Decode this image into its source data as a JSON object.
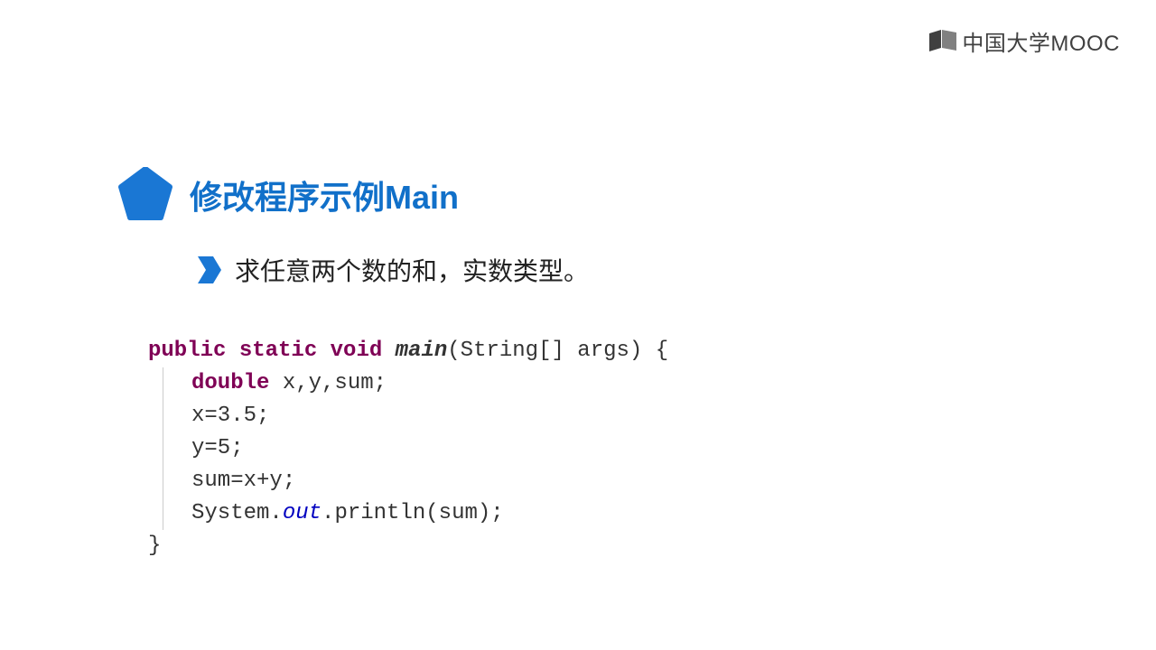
{
  "logo": {
    "text": "中国大学MOOC"
  },
  "title": "修改程序示例Main",
  "subtitle": "求任意两个数的和，实数类型。",
  "code": {
    "kw_publicStaticVoid": "public static void",
    "main": "main",
    "params": "(String[] args) {",
    "kw_double": "double",
    "declVars": " x,y,sum;",
    "assignX": "x=3.5;",
    "assignY": "y=5;",
    "assignSum": "sum=x+y;",
    "sysOut1": "System.",
    "out": "out",
    "sysOut2": ".println(sum);",
    "closeBrace": "}"
  }
}
